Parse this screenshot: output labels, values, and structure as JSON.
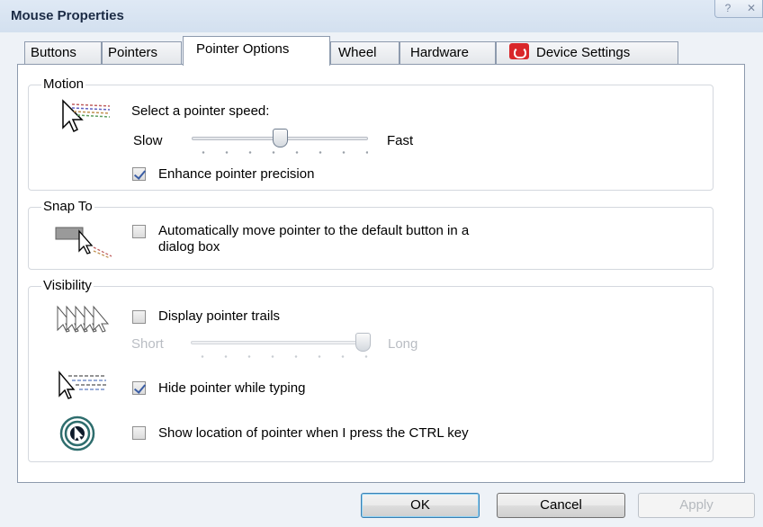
{
  "window": {
    "title": "Mouse Properties",
    "help_glyph": "?",
    "close_glyph": "✕"
  },
  "tabs": [
    {
      "label": "Buttons"
    },
    {
      "label": "Pointers"
    },
    {
      "label": "Pointer Options",
      "active": true
    },
    {
      "label": "Wheel"
    },
    {
      "label": "Hardware"
    },
    {
      "label": "Device Settings"
    }
  ],
  "motion": {
    "title": "Motion",
    "speed_label": "Select a pointer speed:",
    "slow_label": "Slow",
    "fast_label": "Fast",
    "speed_level": 0.5,
    "enhance_precision_label": "Enhance pointer precision",
    "enhance_precision_checked": true
  },
  "snap_to": {
    "title": "Snap To",
    "auto_move_label_line1": "Automatically move pointer to the default button in a",
    "auto_move_label_line2": "dialog box",
    "auto_move_checked": false
  },
  "visibility": {
    "title": "Visibility",
    "trails_label": "Display pointer trails",
    "trails_checked": false,
    "short_label": "Short",
    "long_label": "Long",
    "trail_length_level": 1.0,
    "hide_while_typing_label": "Hide pointer while typing",
    "hide_while_typing_checked": true,
    "show_location_label": "Show location of pointer when I press the CTRL key",
    "show_location_checked": false
  },
  "buttons": {
    "ok": "OK",
    "cancel": "Cancel",
    "apply": "Apply"
  },
  "colors": {
    "accent": "#3c7fb1",
    "device_settings_icon": "#d9272a",
    "check_mark": "#3a5da4"
  }
}
